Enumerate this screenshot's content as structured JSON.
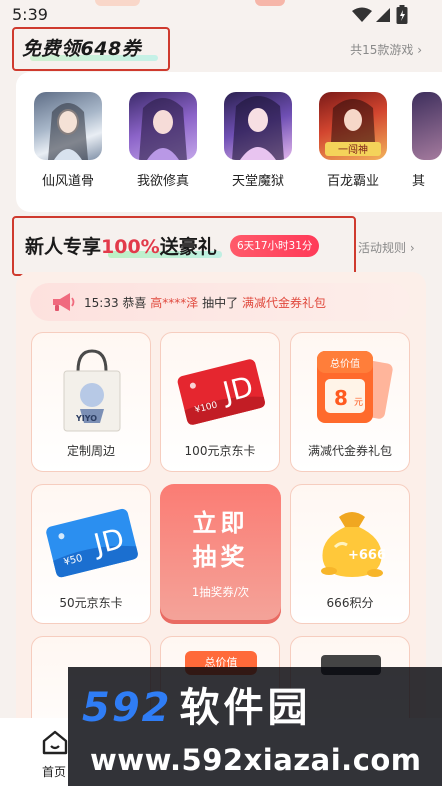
{
  "status_bar": {
    "time": "5:39"
  },
  "free_section": {
    "title": "免费领648券",
    "more": "共15款游戏 ›",
    "games": [
      {
        "name": "仙风道骨",
        "icon": "game-avatar-icon"
      },
      {
        "name": "我欲修真",
        "icon": "game-avatar-icon"
      },
      {
        "name": "天堂魔狱",
        "icon": "game-avatar-icon"
      },
      {
        "name": "百龙霸业",
        "icon": "game-avatar-icon"
      },
      {
        "name": "其",
        "icon": "game-avatar-icon"
      }
    ]
  },
  "newbie_section": {
    "title_prefix": "新人专享",
    "title_highlight": "100%",
    "title_suffix": "送豪礼",
    "countdown": "6天17小时31分",
    "rules": "活动规则 ›",
    "ticker": {
      "time": "15:33",
      "congrats": "恭喜",
      "user": "高****泽",
      "action": "抽中了",
      "prize": "满减代金券礼包"
    },
    "prizes": [
      {
        "label": "定制周边",
        "bag_text": "YIYO"
      },
      {
        "label": "100元京东卡",
        "card_value": "¥100",
        "card_logo": "JD"
      },
      {
        "label": "满减代金券礼包",
        "coupon_title": "总价值",
        "coupon_value": "8",
        "coupon_unit": "元"
      },
      {
        "label": "50元京东卡",
        "card_value": "¥50",
        "card_logo": "JD"
      },
      {
        "label": "666积分",
        "points_badge": "+666"
      },
      {
        "coupon_title": "总价值"
      }
    ],
    "draw": {
      "big": "立即抽奖",
      "sub": "1抽奖券/次"
    }
  },
  "bottom_nav": {
    "home": "首页"
  },
  "watermark": {
    "brand_num": "592",
    "brand_cn": "软件园",
    "url": "www.592xiazai.com"
  },
  "colors": {
    "accent_red": "#cf3a2e",
    "highlight": "#e23a4a",
    "panel": "#fcefe9"
  }
}
